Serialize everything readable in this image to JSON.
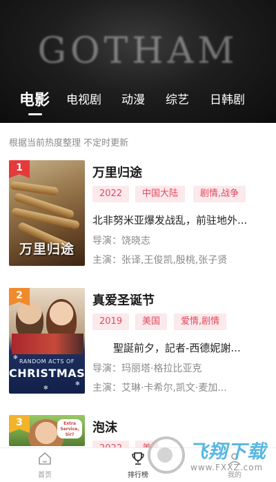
{
  "banner": {
    "title": "GOTHAM"
  },
  "tabs": [
    {
      "label": "电影",
      "active": true
    },
    {
      "label": "电视剧",
      "active": false
    },
    {
      "label": "动漫",
      "active": false
    },
    {
      "label": "综艺",
      "active": false
    },
    {
      "label": "日韩剧",
      "active": false
    }
  ],
  "notice": "根据当前热度整理 不定时更新",
  "movies": [
    {
      "rank": "1",
      "title": "万里归途",
      "poster_text": "万里归途",
      "year": "2022",
      "region": "中国大陆",
      "genre": "剧情,战争",
      "description": "北非努米亚爆发战乱，前驻地外...",
      "director": "导演：饶晓志",
      "cast": "主演：张译,王俊凯,殷桃,张子贤"
    },
    {
      "rank": "2",
      "title": "真爱圣诞节",
      "poster_small_text": "RANDOM ACTS OF",
      "poster_big_text": "CHRISTMAS",
      "year": "2019",
      "region": "美国",
      "genre": "爱情,剧情",
      "description": "　　聖誕前夕，記者-西德妮謝...",
      "director": "导演：玛丽塔·格拉比亚克",
      "cast": "主演：艾琳·卡希尔,凯文·麦加..."
    },
    {
      "rank": "3",
      "title": "泡沫",
      "poster_text": "Extra Service, Sir?",
      "year": "2022",
      "region": "美"
    }
  ],
  "bottom_nav": [
    {
      "label": "首页",
      "icon": "home-icon",
      "active": false
    },
    {
      "label": "排行榜",
      "icon": "trophy-icon",
      "active": true
    },
    {
      "label": "我的",
      "icon": "user-icon",
      "active": false
    }
  ],
  "watermark": {
    "brand": "飞翔下载",
    "url": "www.FXXZ.com"
  },
  "colors": {
    "tag_bg": "#fbe9ec",
    "tag_text": "#e14a5d",
    "rank1": "#e43a3a",
    "rank2": "#f08a2c",
    "rank3": "#f3b32a"
  }
}
